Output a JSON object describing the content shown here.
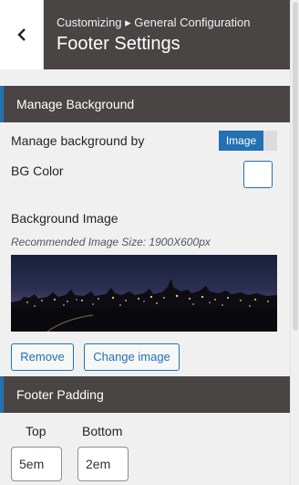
{
  "header": {
    "back_icon": "chevron-left-icon",
    "breadcrumb": "Customizing ▸ General Configuration",
    "title": "Footer Settings"
  },
  "sections": {
    "background": {
      "title": "Manage Background",
      "manage_by_label": "Manage background by",
      "manage_by_value": "Image",
      "bg_color_label": "BG Color",
      "bg_color_value": "#ffffff",
      "bg_image_label": "Background Image",
      "bg_image_hint": "Recommended Image Size: 1900X600px",
      "remove_label": "Remove",
      "change_label": "Change image"
    },
    "padding": {
      "title": "Footer Padding",
      "top_label": "Top",
      "top_value": "5em",
      "bottom_label": "Bottom",
      "bottom_value": "2em"
    }
  },
  "colors": {
    "accent": "#2271b1",
    "section_bg": "#4a4545",
    "panel_bg": "#f0f0f1"
  }
}
